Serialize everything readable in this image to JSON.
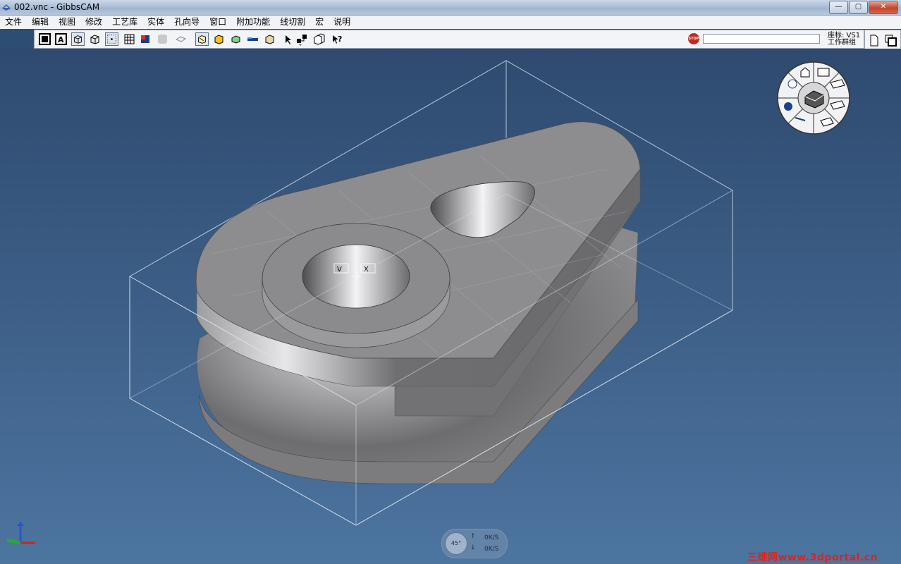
{
  "window": {
    "title": "002.vnc - GibbsCAM",
    "min": "—",
    "max": "▢",
    "close": "✕"
  },
  "menu": [
    "文件",
    "编辑",
    "视图",
    "修改",
    "工艺库",
    "实体",
    "孔向导",
    "窗口",
    "附加功能",
    "线切割",
    "宏",
    "说明"
  ],
  "toolbar": {
    "stop_label": "STOP",
    "coord_label": "座标: VS1",
    "group_label": "工作群组"
  },
  "status": {
    "view_angle": "45°",
    "rate_up": "0K/S",
    "rate_down": "0K/S",
    "arrow_up": "↑",
    "arrow_down": "↓"
  },
  "watermark": "三维网www.3dportal.cn",
  "colors": {
    "viewport_top": "#2e4a6f",
    "viewport_bottom": "#4c75a0",
    "part": "#8a8a8c",
    "bounding_box": "#c8d4e4"
  }
}
